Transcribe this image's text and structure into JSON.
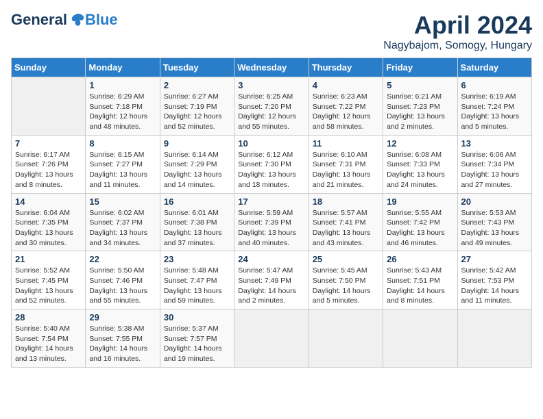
{
  "header": {
    "logo_general": "General",
    "logo_blue": "Blue",
    "month_title": "April 2024",
    "location": "Nagybajom, Somogy, Hungary"
  },
  "calendar": {
    "days_of_week": [
      "Sunday",
      "Monday",
      "Tuesday",
      "Wednesday",
      "Thursday",
      "Friday",
      "Saturday"
    ],
    "weeks": [
      [
        {
          "day": "",
          "content": ""
        },
        {
          "day": "1",
          "content": "Sunrise: 6:29 AM\nSunset: 7:18 PM\nDaylight: 12 hours\nand 48 minutes."
        },
        {
          "day": "2",
          "content": "Sunrise: 6:27 AM\nSunset: 7:19 PM\nDaylight: 12 hours\nand 52 minutes."
        },
        {
          "day": "3",
          "content": "Sunrise: 6:25 AM\nSunset: 7:20 PM\nDaylight: 12 hours\nand 55 minutes."
        },
        {
          "day": "4",
          "content": "Sunrise: 6:23 AM\nSunset: 7:22 PM\nDaylight: 12 hours\nand 58 minutes."
        },
        {
          "day": "5",
          "content": "Sunrise: 6:21 AM\nSunset: 7:23 PM\nDaylight: 13 hours\nand 2 minutes."
        },
        {
          "day": "6",
          "content": "Sunrise: 6:19 AM\nSunset: 7:24 PM\nDaylight: 13 hours\nand 5 minutes."
        }
      ],
      [
        {
          "day": "7",
          "content": "Sunrise: 6:17 AM\nSunset: 7:26 PM\nDaylight: 13 hours\nand 8 minutes."
        },
        {
          "day": "8",
          "content": "Sunrise: 6:15 AM\nSunset: 7:27 PM\nDaylight: 13 hours\nand 11 minutes."
        },
        {
          "day": "9",
          "content": "Sunrise: 6:14 AM\nSunset: 7:29 PM\nDaylight: 13 hours\nand 14 minutes."
        },
        {
          "day": "10",
          "content": "Sunrise: 6:12 AM\nSunset: 7:30 PM\nDaylight: 13 hours\nand 18 minutes."
        },
        {
          "day": "11",
          "content": "Sunrise: 6:10 AM\nSunset: 7:31 PM\nDaylight: 13 hours\nand 21 minutes."
        },
        {
          "day": "12",
          "content": "Sunrise: 6:08 AM\nSunset: 7:33 PM\nDaylight: 13 hours\nand 24 minutes."
        },
        {
          "day": "13",
          "content": "Sunrise: 6:06 AM\nSunset: 7:34 PM\nDaylight: 13 hours\nand 27 minutes."
        }
      ],
      [
        {
          "day": "14",
          "content": "Sunrise: 6:04 AM\nSunset: 7:35 PM\nDaylight: 13 hours\nand 30 minutes."
        },
        {
          "day": "15",
          "content": "Sunrise: 6:02 AM\nSunset: 7:37 PM\nDaylight: 13 hours\nand 34 minutes."
        },
        {
          "day": "16",
          "content": "Sunrise: 6:01 AM\nSunset: 7:38 PM\nDaylight: 13 hours\nand 37 minutes."
        },
        {
          "day": "17",
          "content": "Sunrise: 5:59 AM\nSunset: 7:39 PM\nDaylight: 13 hours\nand 40 minutes."
        },
        {
          "day": "18",
          "content": "Sunrise: 5:57 AM\nSunset: 7:41 PM\nDaylight: 13 hours\nand 43 minutes."
        },
        {
          "day": "19",
          "content": "Sunrise: 5:55 AM\nSunset: 7:42 PM\nDaylight: 13 hours\nand 46 minutes."
        },
        {
          "day": "20",
          "content": "Sunrise: 5:53 AM\nSunset: 7:43 PM\nDaylight: 13 hours\nand 49 minutes."
        }
      ],
      [
        {
          "day": "21",
          "content": "Sunrise: 5:52 AM\nSunset: 7:45 PM\nDaylight: 13 hours\nand 52 minutes."
        },
        {
          "day": "22",
          "content": "Sunrise: 5:50 AM\nSunset: 7:46 PM\nDaylight: 13 hours\nand 55 minutes."
        },
        {
          "day": "23",
          "content": "Sunrise: 5:48 AM\nSunset: 7:47 PM\nDaylight: 13 hours\nand 59 minutes."
        },
        {
          "day": "24",
          "content": "Sunrise: 5:47 AM\nSunset: 7:49 PM\nDaylight: 14 hours\nand 2 minutes."
        },
        {
          "day": "25",
          "content": "Sunrise: 5:45 AM\nSunset: 7:50 PM\nDaylight: 14 hours\nand 5 minutes."
        },
        {
          "day": "26",
          "content": "Sunrise: 5:43 AM\nSunset: 7:51 PM\nDaylight: 14 hours\nand 8 minutes."
        },
        {
          "day": "27",
          "content": "Sunrise: 5:42 AM\nSunset: 7:53 PM\nDaylight: 14 hours\nand 11 minutes."
        }
      ],
      [
        {
          "day": "28",
          "content": "Sunrise: 5:40 AM\nSunset: 7:54 PM\nDaylight: 14 hours\nand 13 minutes."
        },
        {
          "day": "29",
          "content": "Sunrise: 5:38 AM\nSunset: 7:55 PM\nDaylight: 14 hours\nand 16 minutes."
        },
        {
          "day": "30",
          "content": "Sunrise: 5:37 AM\nSunset: 7:57 PM\nDaylight: 14 hours\nand 19 minutes."
        },
        {
          "day": "",
          "content": ""
        },
        {
          "day": "",
          "content": ""
        },
        {
          "day": "",
          "content": ""
        },
        {
          "day": "",
          "content": ""
        }
      ]
    ]
  }
}
